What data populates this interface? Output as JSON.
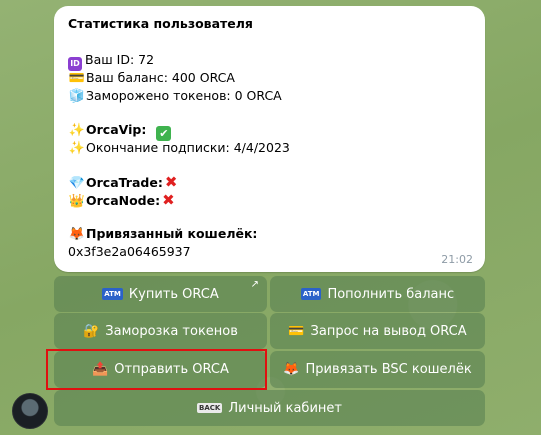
{
  "message": {
    "title": "Статистика пользователя",
    "id_label": "Ваш ID: 72",
    "balance_label": "Ваш баланс: 400 ORCA",
    "frozen_label": "Заморожено токенов: 0 ORCA",
    "vip_label": "OrcaVip:",
    "subscription_label": "Окончание подписки: 4/4/2023",
    "trade_label": "OrcaTrade:",
    "node_label": "OrcaNode:",
    "wallet_label": "Привязанный кошелёк:",
    "wallet_value": "0x3f3e2a06465937",
    "time": "21:02",
    "id_badge": "ID",
    "check": "✔",
    "cross": "✖"
  },
  "keyboard": {
    "buy": "Купить ORCA",
    "topup": "Пополнить баланс",
    "freeze": "Заморозка токенов",
    "withdraw": "Запрос на вывод ORCA",
    "send": "Отправить ORCA",
    "bind": "Привязать BSC кошелёк",
    "cabinet": "Личный кабинет",
    "atm_text": "ATM",
    "back_text": "BACK"
  },
  "icons": {
    "id": "id-badge-icon",
    "balance": "credit-card-icon",
    "frozen": "ice-cube-icon",
    "sparkles": "sparkles-icon",
    "check": "check-mark-icon",
    "diamond": "diamond-icon",
    "crown": "crown-icon",
    "cross": "cross-mark-icon",
    "fox": "fox-icon",
    "atm": "atm-icon",
    "lock": "lock-key-icon",
    "card": "card-icon",
    "outbox": "outbox-tray-icon",
    "back": "back-arrow-icon",
    "external": "external-link-icon"
  }
}
